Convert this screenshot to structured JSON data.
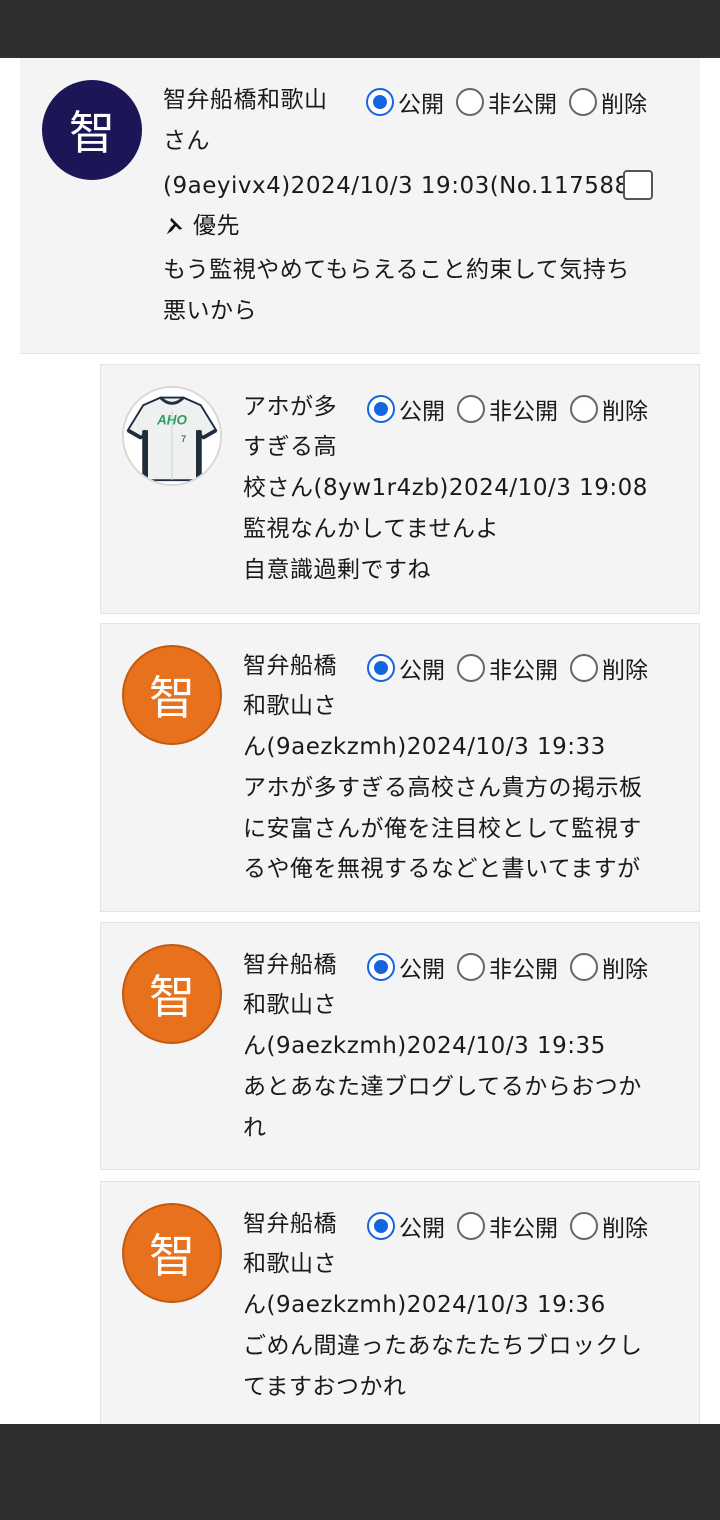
{
  "radio_options": [
    "公開",
    "非公開",
    "削除"
  ],
  "colors": {
    "accent": "#1565e0",
    "navy_avatar": "#1c1657",
    "orange_avatar": "#e8711d"
  },
  "posts": [
    {
      "avatar_char": "智",
      "author_lines": [
        "智弁船橋和歌山",
        "さん"
      ],
      "meta": "(9aeyivx4)2024/10/3 19:03(No.117588)",
      "priority_label": "優先",
      "priority_icon": "pushpin-icon",
      "body": [
        "もう監視やめてもらえること約束して気持ち",
        "悪いから"
      ],
      "selected": "公開"
    },
    {
      "avatar_image": "baseball-jersey",
      "jersey_text": "AHO",
      "jersey_number": "7",
      "author_lines": [
        "アホが多",
        "すぎる高",
        "校さん(8yw1r4zb)2024/10/3 19:08"
      ],
      "body": [
        "監視なんかしてませんよ",
        "自意識過剰ですね"
      ],
      "selected": "公開"
    },
    {
      "avatar_char": "智",
      "author_lines": [
        "智弁船橋",
        "和歌山さ",
        "ん(9aezkzmh)2024/10/3 19:33"
      ],
      "body": [
        "アホが多すぎる高校さん貴方の掲示板",
        "に安富さんが俺を注目校として監視す",
        "るや俺を無視するなどと書いてますが"
      ],
      "selected": "公開"
    },
    {
      "avatar_char": "智",
      "author_lines": [
        "智弁船橋",
        "和歌山さ",
        "ん(9aezkzmh)2024/10/3 19:35"
      ],
      "body": [
        "あとあなた達ブログしてるからおつか",
        "れ"
      ],
      "selected": "公開"
    },
    {
      "avatar_char": "智",
      "author_lines": [
        "智弁船橋",
        "和歌山さ",
        "ん(9aezkzmh)2024/10/3 19:36"
      ],
      "body": [
        "ごめん間違ったあなたたちブロックし",
        "てますおつかれ"
      ],
      "selected": "公開"
    }
  ]
}
